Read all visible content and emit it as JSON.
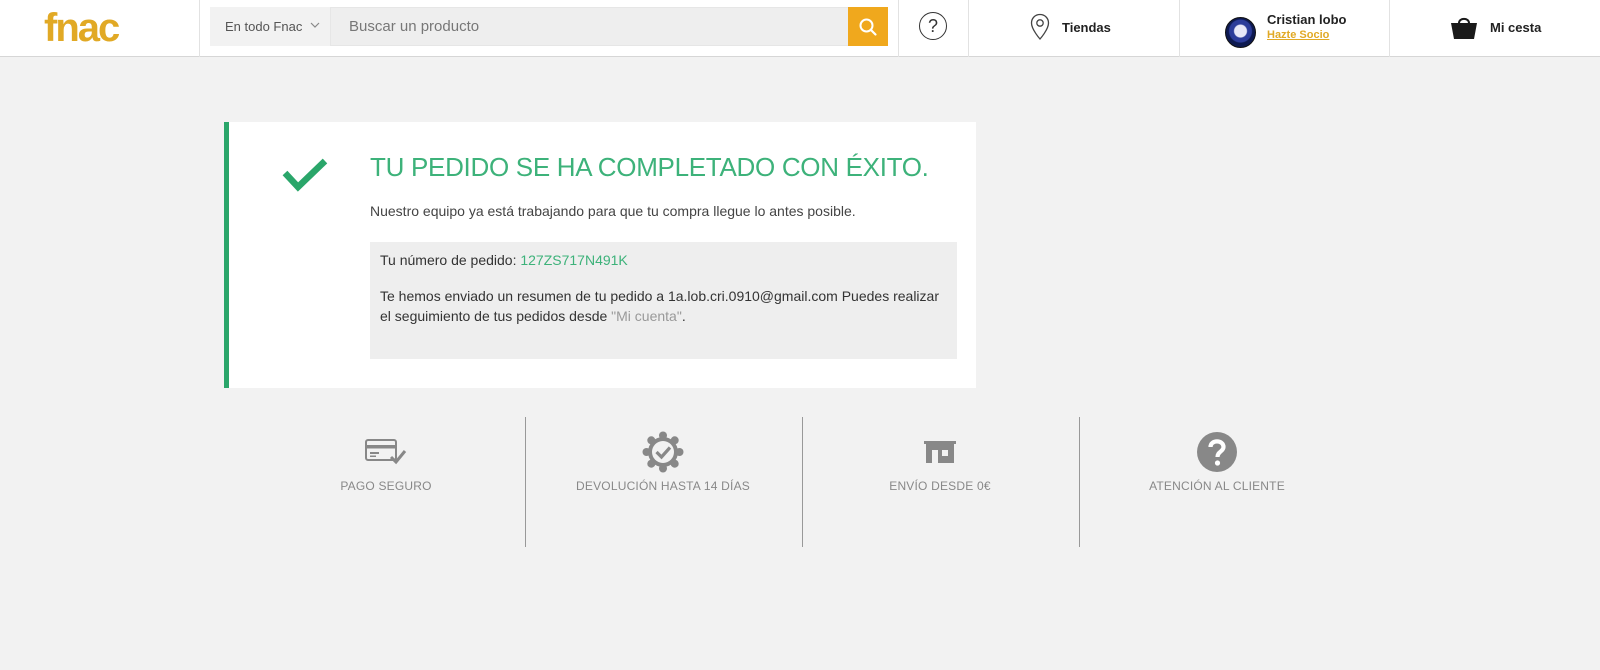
{
  "brand": {
    "logo_text": "fnac",
    "accent_color": "#e1a925"
  },
  "header": {
    "scope_label": "En todo Fnac",
    "search_placeholder": "Buscar un producto",
    "help_glyph": "?",
    "stores_label": "Tiendas",
    "account": {
      "name": "Cristian lobo",
      "link_label": "Hazte Socio"
    },
    "cart_label": "Mi cesta",
    "icons": [
      "chevron-down-icon",
      "search-icon",
      "help-icon",
      "location-pin-icon",
      "avatar",
      "basket-icon"
    ]
  },
  "confirmation": {
    "title": "TU PEDIDO SE HA COMPLETADO CON ÉXITO.",
    "subtitle": "Nuestro equipo ya está trabajando para que tu compra llegue lo antes posible.",
    "order_label": "Tu número de pedido:",
    "order_number": "127ZS717N491K",
    "summary_text": "Te hemos enviado un resumen de tu pedido a 1a.lob.cri.0910@gmail.com Puedes realizar el seguimiento de tus pedidos desde",
    "account_link": "\"Mi cuenta\"",
    "summary_end": ".",
    "success_color": "#3db27a",
    "icon": "check-icon"
  },
  "features": [
    {
      "label": "PAGO SEGURO",
      "icon": "credit-card-check-icon"
    },
    {
      "label": "DEVOLUCIÓN HASTA 14 DÍAS",
      "icon": "badge-check-icon"
    },
    {
      "label": "ENVÍO DESDE 0€",
      "icon": "store-icon"
    },
    {
      "label": "ATENCIÓN AL CLIENTE",
      "icon": "question-circle-icon"
    }
  ]
}
